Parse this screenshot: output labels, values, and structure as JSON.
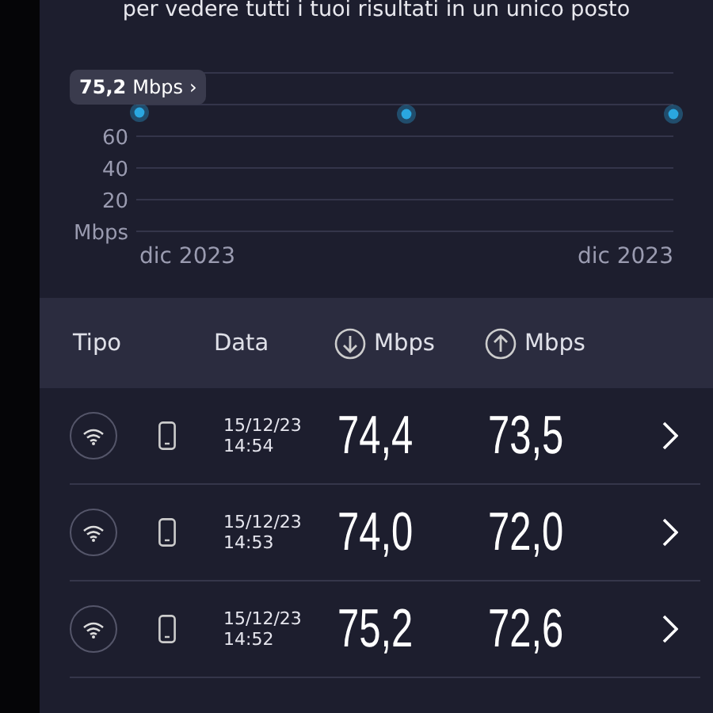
{
  "subtitle": "per vedere tutti i tuoi risultati in un unico posto",
  "chart": {
    "tooltip": {
      "value": "75,2",
      "unit": "Mbps",
      "arrow": "›"
    },
    "chart_data": {
      "type": "scatter",
      "grid": true,
      "ylabel": "Mbps",
      "categories": [
        "dic 2023",
        null,
        "dic 2023"
      ],
      "ylim": [
        0,
        100
      ],
      "yticks": [
        20,
        40,
        60
      ],
      "series": [
        {
          "color": "#2aa7e0",
          "values": [
            75,
            74,
            74
          ]
        }
      ]
    }
  },
  "table": {
    "columns": [
      {
        "label": "Tipo",
        "kind": "text"
      },
      {
        "label": "Data",
        "kind": "text"
      },
      {
        "label": "Mbps",
        "kind": "download"
      },
      {
        "label": "Mbps",
        "kind": "upload"
      }
    ],
    "rows": [
      {
        "date": "15/12/23",
        "time": "14:54",
        "download": "74,4",
        "upload": "73,5"
      },
      {
        "date": "15/12/23",
        "time": "14:53",
        "download": "74,0",
        "upload": "72,0"
      },
      {
        "date": "15/12/23",
        "time": "14:52",
        "download": "75,2",
        "upload": "72,6"
      }
    ]
  }
}
